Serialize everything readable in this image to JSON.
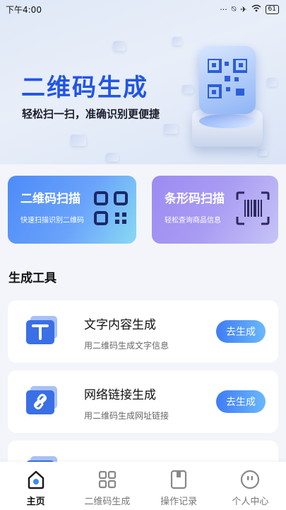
{
  "status_bar": {
    "time": "下午4:00",
    "battery": "61"
  },
  "hero": {
    "title": "二维码生成",
    "subtitle": "轻松扫一扫，准确识别更便捷"
  },
  "feature_cards": [
    {
      "title": "二维码扫描",
      "subtitle": "快速扫描识别二维码",
      "icon": "qr-code-icon"
    },
    {
      "title": "条形码扫描",
      "subtitle": "轻松查询商品信息",
      "icon": "barcode-icon"
    }
  ],
  "section": {
    "title": "生成工具"
  },
  "tools": [
    {
      "title": "文字内容生成",
      "desc": "用二维码生成文字信息",
      "button": "去生成",
      "icon": "text-icon"
    },
    {
      "title": "网络链接生成",
      "desc": "用二维码生成网址链接",
      "button": "去生成",
      "icon": "link-icon"
    }
  ],
  "bottom_nav": [
    {
      "label": "主页",
      "icon": "home-icon",
      "active": true
    },
    {
      "label": "二维码生成",
      "icon": "qr-grid-icon",
      "active": false
    },
    {
      "label": "操作记录",
      "icon": "record-icon",
      "active": false
    },
    {
      "label": "个人中心",
      "icon": "profile-icon",
      "active": false
    }
  ],
  "colors": {
    "accent": "#2155e8",
    "scan_card": "#4d8bf8",
    "barcode_card": "#9c8bf2"
  }
}
